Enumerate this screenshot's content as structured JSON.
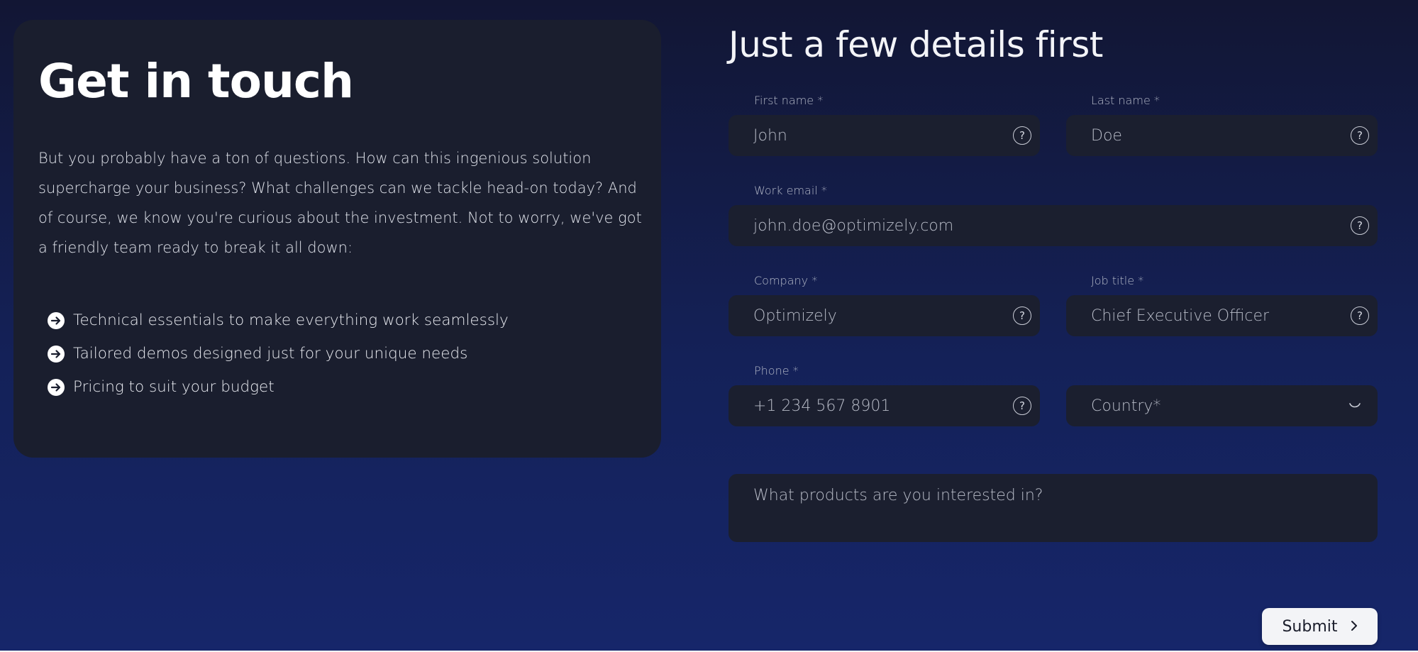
{
  "left_card": {
    "title": "Get in touch",
    "intro": "But you probably have a ton of questions. How can this ingenious solution supercharge your business? What challenges can we tackle head-on today? And of course, we know you're curious about the investment. Not to worry, we've got a friendly team ready to break it all down:",
    "bullets": [
      "Technical essentials to make everything work seamlessly",
      "Tailored demos designed just for your unique needs",
      "Pricing to suit your budget"
    ],
    "bullet_icon": "arrow-right-circle-icon"
  },
  "form": {
    "title": "Just a few details first",
    "first_name": {
      "label": "First name *",
      "placeholder": "John",
      "value": ""
    },
    "last_name": {
      "label": "Last name *",
      "placeholder": "Doe",
      "value": ""
    },
    "work_email": {
      "label": "Work email *",
      "placeholder": "john.doe@optimizely.com",
      "value": ""
    },
    "company": {
      "label": "Company *",
      "placeholder": "Optimizely",
      "value": ""
    },
    "job_title": {
      "label": "Job title *",
      "placeholder": "Chief Executive Officer",
      "value": ""
    },
    "phone": {
      "label": "Phone *",
      "placeholder": "+1 234 567 8901",
      "value": ""
    },
    "country": {
      "selected": "Country*"
    },
    "products": {
      "placeholder": "What products are you interested in?"
    },
    "help_icon": "question-circle-icon",
    "submit_label": "Submit"
  },
  "colors": {
    "background_top": "#121634",
    "background_bottom": "#16266a",
    "card": "#1a1e2e",
    "field": "#1b1f2f",
    "button": "#f3f4f7"
  }
}
